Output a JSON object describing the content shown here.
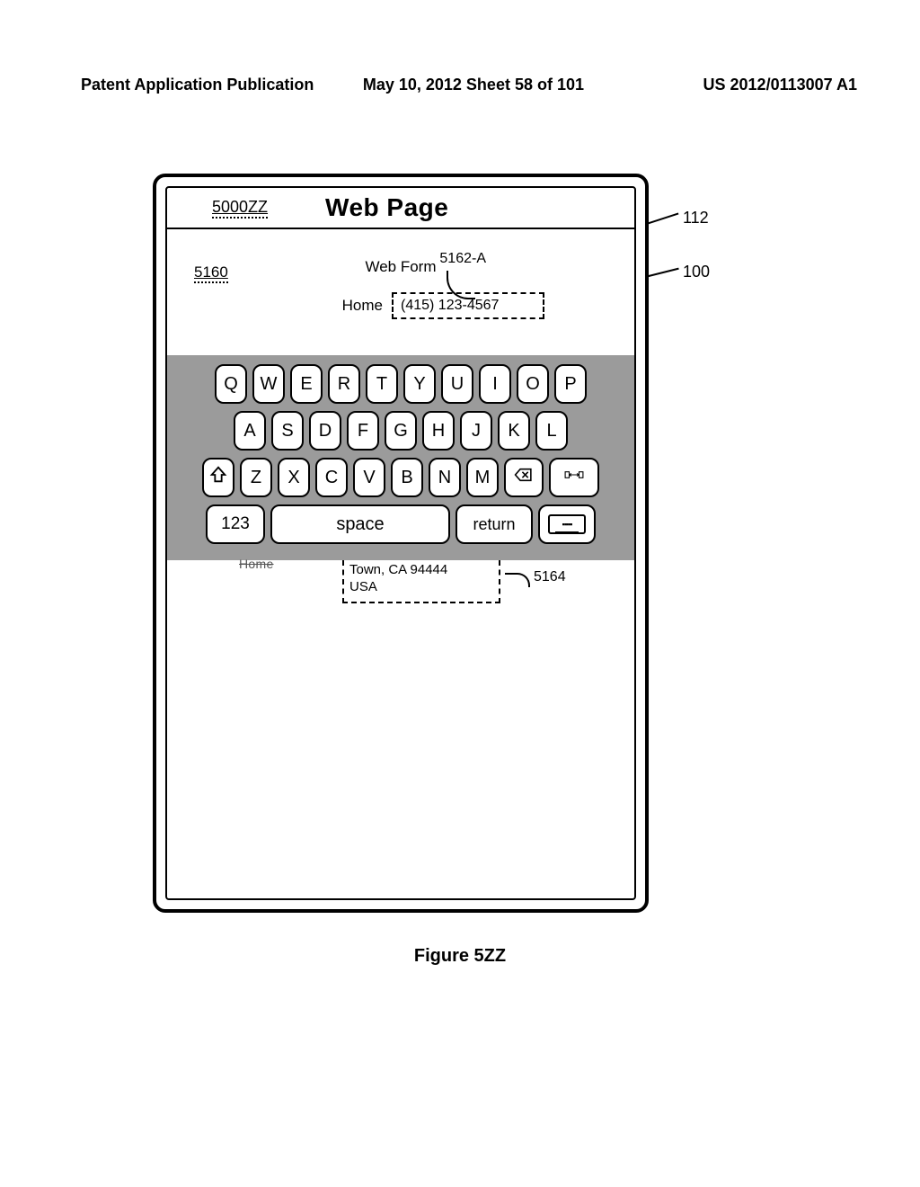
{
  "header": {
    "left": "Patent Application Publication",
    "mid": "May 10, 2012  Sheet 58 of 101",
    "right": "US 2012/0113007 A1"
  },
  "device": {
    "ref112": "112",
    "ref100": "100",
    "titlebar": {
      "ref": "5000ZZ",
      "title": "Web Page"
    },
    "form": {
      "ref": "5160",
      "title": "Web Form",
      "callout_a": "5162-A",
      "row1": {
        "label": "Home",
        "value": "(415) 123-4567"
      }
    },
    "keyboard": {
      "row1": [
        "Q",
        "W",
        "E",
        "R",
        "T",
        "Y",
        "U",
        "I",
        "O",
        "P"
      ],
      "row2": [
        "A",
        "S",
        "D",
        "F",
        "G",
        "H",
        "J",
        "K",
        "L"
      ],
      "row3": [
        "Z",
        "X",
        "C",
        "V",
        "B",
        "N",
        "M"
      ],
      "num": "123",
      "space": "space",
      "ret": "return"
    },
    "below": {
      "rowlabel": "Home",
      "address": [
        "Town, CA 94444",
        "USA"
      ],
      "callout_b": "5164"
    }
  },
  "caption": "Figure 5ZZ"
}
